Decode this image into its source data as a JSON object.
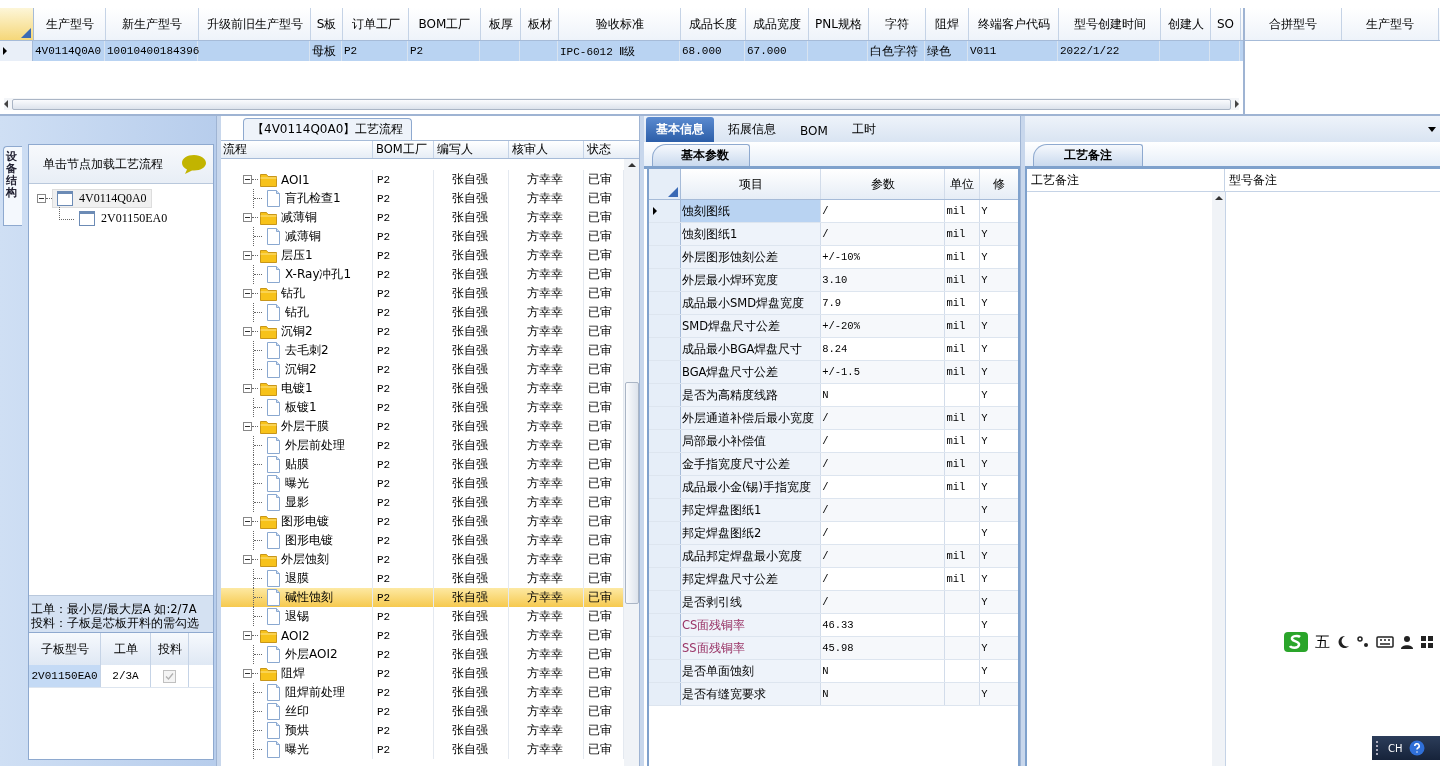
{
  "top_table": {
    "columns": [
      "生产型号",
      "新生产型号",
      "升级前旧生产型号",
      "S板",
      "订单工厂",
      "BOM工厂",
      "板厚",
      "板材",
      "验收标准",
      "成品长度",
      "成品宽度",
      "PNL规格",
      "字符",
      "阻焊",
      "终端客户代码",
      "型号创建时间",
      "创建人",
      "SO"
    ],
    "rows": [
      {
        "selected": true,
        "cells": [
          "4V0114Q0A0",
          "10010400184396",
          null,
          "母板",
          "P2",
          "P2",
          null,
          null,
          "IPC-6012 Ⅱ级",
          "68.000",
          "67.000",
          null,
          "白色字符",
          "绿色",
          "V011",
          "2022/1/22",
          null,
          null
        ]
      }
    ]
  },
  "merge_table": {
    "columns": [
      "合拼型号",
      "生产型号"
    ]
  },
  "structure_panel": {
    "vertical_tab": "设备结构",
    "hint": "单击节点加载工艺流程",
    "tree": [
      {
        "label": "4V0114Q0A0",
        "expanded": true,
        "selected": true,
        "children": [
          {
            "label": "2V01150EA0",
            "selected": false
          }
        ]
      }
    ],
    "notes": [
      "工单：最小层/最大层A 如:2/7A",
      "投料：子板是芯板开料的需勾选"
    ],
    "sub_table": {
      "columns": [
        "子板型号",
        "工单",
        "投料"
      ],
      "rows": [
        {
          "cells": [
            "2V01150EA0",
            "2/3A"
          ],
          "checked": true
        }
      ]
    }
  },
  "flow_panel": {
    "title": "【4V0114Q0A0】工艺流程",
    "columns": [
      "流程",
      "BOM工厂",
      "编写人",
      "核审人",
      "状态"
    ],
    "rows": [
      {
        "kind": "group",
        "name": "AOI1",
        "bom": "P2",
        "writer": "张自强",
        "reviewer": "方幸幸",
        "status": "已审",
        "selected": false,
        "expanded": true,
        "children": [
          {
            "kind": "step",
            "name": "盲孔检查1",
            "bom": "P2",
            "writer": "张自强",
            "reviewer": "方幸幸",
            "status": "已审",
            "selected": false
          }
        ]
      },
      {
        "kind": "group",
        "name": "减薄铜",
        "bom": "P2",
        "writer": "张自强",
        "reviewer": "方幸幸",
        "status": "已审",
        "selected": false,
        "expanded": true,
        "children": [
          {
            "kind": "step",
            "name": "减薄铜",
            "bom": "P2",
            "writer": "张自强",
            "reviewer": "方幸幸",
            "status": "已审",
            "selected": false
          }
        ]
      },
      {
        "kind": "group",
        "name": "层压1",
        "bom": "P2",
        "writer": "张自强",
        "reviewer": "方幸幸",
        "status": "已审",
        "selected": false,
        "expanded": true,
        "children": [
          {
            "kind": "step",
            "name": "X-Ray冲孔1",
            "bom": "P2",
            "writer": "张自强",
            "reviewer": "方幸幸",
            "status": "已审",
            "selected": false
          }
        ]
      },
      {
        "kind": "group",
        "name": "钻孔",
        "bom": "P2",
        "writer": "张自强",
        "reviewer": "方幸幸",
        "status": "已审",
        "selected": false,
        "expanded": true,
        "children": [
          {
            "kind": "step",
            "name": "钻孔",
            "bom": "P2",
            "writer": "张自强",
            "reviewer": "方幸幸",
            "status": "已审",
            "selected": false
          }
        ]
      },
      {
        "kind": "group",
        "name": "沉铜2",
        "bom": "P2",
        "writer": "张自强",
        "reviewer": "方幸幸",
        "status": "已审",
        "selected": false,
        "expanded": true,
        "children": [
          {
            "kind": "step",
            "name": "去毛刺2",
            "bom": "P2",
            "writer": "张自强",
            "reviewer": "方幸幸",
            "status": "已审",
            "selected": false
          },
          {
            "kind": "step",
            "name": "沉铜2",
            "bom": "P2",
            "writer": "张自强",
            "reviewer": "方幸幸",
            "status": "已审",
            "selected": false
          }
        ]
      },
      {
        "kind": "group",
        "name": "电镀1",
        "bom": "P2",
        "writer": "张自强",
        "reviewer": "方幸幸",
        "status": "已审",
        "selected": false,
        "expanded": true,
        "children": [
          {
            "kind": "step",
            "name": "板镀1",
            "bom": "P2",
            "writer": "张自强",
            "reviewer": "方幸幸",
            "status": "已审",
            "selected": false
          }
        ]
      },
      {
        "kind": "group",
        "name": "外层干膜",
        "bom": "P2",
        "writer": "张自强",
        "reviewer": "方幸幸",
        "status": "已审",
        "selected": false,
        "expanded": true,
        "children": [
          {
            "kind": "step",
            "name": "外层前处理",
            "bom": "P2",
            "writer": "张自强",
            "reviewer": "方幸幸",
            "status": "已审",
            "selected": false
          },
          {
            "kind": "step",
            "name": "贴膜",
            "bom": "P2",
            "writer": "张自强",
            "reviewer": "方幸幸",
            "status": "已审",
            "selected": false
          },
          {
            "kind": "step",
            "name": "曝光",
            "bom": "P2",
            "writer": "张自强",
            "reviewer": "方幸幸",
            "status": "已审",
            "selected": false
          },
          {
            "kind": "step",
            "name": "显影",
            "bom": "P2",
            "writer": "张自强",
            "reviewer": "方幸幸",
            "status": "已审",
            "selected": false
          }
        ]
      },
      {
        "kind": "group",
        "name": "图形电镀",
        "bom": "P2",
        "writer": "张自强",
        "reviewer": "方幸幸",
        "status": "已审",
        "selected": false,
        "expanded": true,
        "children": [
          {
            "kind": "step",
            "name": "图形电镀",
            "bom": "P2",
            "writer": "张自强",
            "reviewer": "方幸幸",
            "status": "已审",
            "selected": false
          }
        ]
      },
      {
        "kind": "group",
        "name": "外层蚀刻",
        "bom": "P2",
        "writer": "张自强",
        "reviewer": "方幸幸",
        "status": "已审",
        "selected": false,
        "expanded": true,
        "children": [
          {
            "kind": "step",
            "name": "退膜",
            "bom": "P2",
            "writer": "张自强",
            "reviewer": "方幸幸",
            "status": "已审",
            "selected": false
          },
          {
            "kind": "step",
            "name": "碱性蚀刻",
            "bom": "P2",
            "writer": "张自强",
            "reviewer": "方幸幸",
            "status": "已审",
            "selected": true
          },
          {
            "kind": "step",
            "name": "退锡",
            "bom": "P2",
            "writer": "张自强",
            "reviewer": "方幸幸",
            "status": "已审",
            "selected": false
          }
        ]
      },
      {
        "kind": "group",
        "name": "AOI2",
        "bom": "P2",
        "writer": "张自强",
        "reviewer": "方幸幸",
        "status": "已审",
        "selected": false,
        "expanded": true,
        "children": [
          {
            "kind": "step",
            "name": "外层AOI2",
            "bom": "P2",
            "writer": "张自强",
            "reviewer": "方幸幸",
            "status": "已审",
            "selected": false
          }
        ]
      },
      {
        "kind": "group",
        "name": "阻焊",
        "bom": "P2",
        "writer": "张自强",
        "reviewer": "方幸幸",
        "status": "已审",
        "selected": false,
        "expanded": true,
        "children": [
          {
            "kind": "step",
            "name": "阻焊前处理",
            "bom": "P2",
            "writer": "张自强",
            "reviewer": "方幸幸",
            "status": "已审",
            "selected": false
          },
          {
            "kind": "step",
            "name": "丝印",
            "bom": "P2",
            "writer": "张自强",
            "reviewer": "方幸幸",
            "status": "已审",
            "selected": false
          },
          {
            "kind": "step",
            "name": "预烘",
            "bom": "P2",
            "writer": "张自强",
            "reviewer": "方幸幸",
            "status": "已审",
            "selected": false
          },
          {
            "kind": "step",
            "name": "曝光",
            "bom": "P2",
            "writer": "张自强",
            "reviewer": "方幸幸",
            "status": "已审",
            "selected": false
          }
        ]
      }
    ]
  },
  "info_panel": {
    "tabs": [
      {
        "label": "基本信息",
        "selected": true
      },
      {
        "label": "拓展信息",
        "selected": false
      },
      {
        "label": "BOM",
        "selected": false
      },
      {
        "label": "工时",
        "selected": false
      }
    ],
    "subtab": "基本参数",
    "columns": [
      "项目",
      "参数",
      "单位",
      "修"
    ],
    "rows": [
      {
        "item": "蚀刻图纸",
        "value": "/",
        "unit": "mil",
        "modify": "Y",
        "selected": true
      },
      {
        "item": "蚀刻图纸1",
        "value": "/",
        "unit": "mil",
        "modify": "Y",
        "selected": false
      },
      {
        "item": "外层图形蚀刻公差",
        "value": "+/-10%",
        "unit": "mil",
        "modify": "Y",
        "selected": false
      },
      {
        "item": "外层最小焊环宽度",
        "value": "3.10",
        "unit": "mil",
        "modify": "Y",
        "selected": false
      },
      {
        "item": "成品最小SMD焊盘宽度",
        "value": "7.9",
        "unit": "mil",
        "modify": "Y",
        "selected": false
      },
      {
        "item": "SMD焊盘尺寸公差",
        "value": "+/-20%",
        "unit": "mil",
        "modify": "Y",
        "selected": false
      },
      {
        "item": "成品最小BGA焊盘尺寸",
        "value": "8.24",
        "unit": "mil",
        "modify": "Y",
        "selected": false
      },
      {
        "item": "BGA焊盘尺寸公差",
        "value": "+/-1.5",
        "unit": "mil",
        "modify": "Y",
        "selected": false
      },
      {
        "item": "是否为高精度线路",
        "value": "N",
        "modify": "Y",
        "selected": false
      },
      {
        "item": "外层通道补偿后最小宽度",
        "value": "/",
        "unit": "mil",
        "modify": "Y",
        "selected": false
      },
      {
        "item": "局部最小补偿值",
        "value": "/",
        "unit": "mil",
        "modify": "Y",
        "selected": false
      },
      {
        "item": "金手指宽度尺寸公差",
        "value": "/",
        "unit": "mil",
        "modify": "Y",
        "selected": false
      },
      {
        "item": "成品最小金(锡)手指宽度",
        "value": "/",
        "unit": "mil",
        "modify": "Y",
        "selected": false
      },
      {
        "item": "邦定焊盘图纸1",
        "value": "/",
        "modify": "Y",
        "selected": false
      },
      {
        "item": "邦定焊盘图纸2",
        "value": "/",
        "modify": "Y",
        "selected": false
      },
      {
        "item": "成品邦定焊盘最小宽度",
        "value": "/",
        "unit": "mil",
        "modify": "Y",
        "selected": false
      },
      {
        "item": "邦定焊盘尺寸公差",
        "value": "/",
        "unit": "mil",
        "modify": "Y",
        "selected": false
      },
      {
        "item": "是否剥引线",
        "value": "/",
        "modify": "Y",
        "selected": false
      },
      {
        "item": "CS面残铜率",
        "value": "46.33",
        "modify": "Y",
        "selected": false,
        "color": "#993366"
      },
      {
        "item": "SS面残铜率",
        "value": "45.98",
        "modify": "Y",
        "selected": false,
        "color": "#993366"
      },
      {
        "item": "是否单面蚀刻",
        "value": "N",
        "modify": "Y",
        "selected": false
      },
      {
        "item": "是否有缝宽要求",
        "value": "N",
        "modify": "Y",
        "selected": false
      }
    ]
  },
  "notes_panel": {
    "tab": "工艺备注",
    "columns": [
      "工艺备注",
      "型号备注"
    ]
  },
  "ime_bar": {
    "mode": "五"
  },
  "language_indicator": "CH"
}
